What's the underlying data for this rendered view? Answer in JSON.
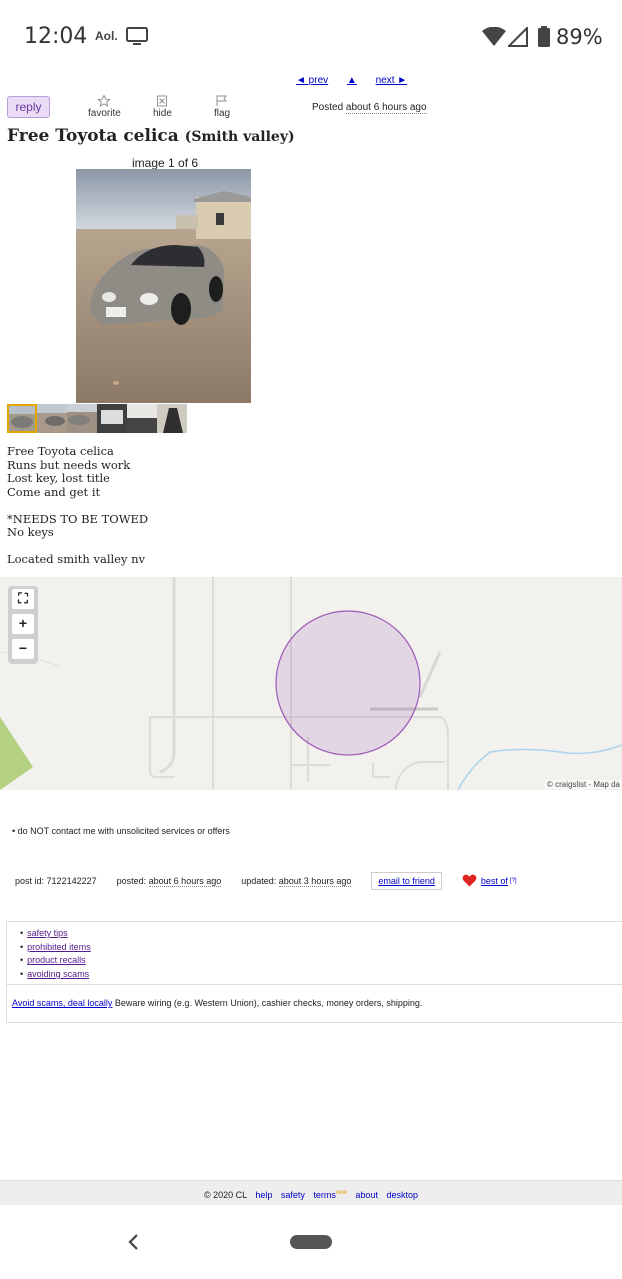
{
  "status_bar": {
    "time": "12:04",
    "carrier": "Aol.",
    "battery": "89%"
  },
  "nav": {
    "prev": "◄ prev",
    "up": "▲",
    "next": "next ►"
  },
  "actions": {
    "reply": "reply",
    "favorite": "favorite",
    "hide": "hide",
    "flag": "flag"
  },
  "posted_top": {
    "label": "Posted",
    "date": "about 6 hours ago"
  },
  "listing": {
    "title": "Free Toyota celica",
    "location": "(Smith valley)",
    "image_counter": "image 1 of 6",
    "thumbnail_count": 6,
    "selected_thumbnail": 1
  },
  "description": {
    "paragraphs": [
      [
        "Free Toyota celica",
        "Runs but needs work",
        "Lost key, lost title",
        "Come and get it"
      ],
      [
        "*NEEDS TO BE TOWED",
        "No keys"
      ],
      [
        "Located smith valley nv"
      ]
    ]
  },
  "map": {
    "fullscreen": "⛶",
    "zoom_in": "+",
    "zoom_out": "−",
    "attribution": "© craigslist - Map da"
  },
  "notice": "do NOT contact me with unsolicited services or offers",
  "post_info": {
    "post_id_label": "post id:",
    "post_id": "7122142227",
    "posted_label": "posted:",
    "posted": "about 6 hours ago",
    "updated_label": "updated:",
    "updated": "about 3 hours ago",
    "email": "email to friend",
    "best_of": "best of",
    "best_of_sup": "[?]"
  },
  "safety": {
    "links": [
      "safety tips",
      "prohibited items",
      "product recalls",
      "avoiding scams"
    ],
    "scam_link": "Avoid scams, deal locally",
    "scam_text": "Beware wiring (e.g. Western Union), cashier checks, money orders, shipping."
  },
  "footer": {
    "copyright": "© 2020 CL",
    "help": "help",
    "safety": "safety",
    "terms": "terms",
    "terms_badge": "new",
    "about": "about",
    "desktop": "desktop"
  },
  "colors": {
    "link": "#0000cc",
    "visited": "#551a8b",
    "reply_bg": "#eadcf6",
    "map_circle": "#9b59b6"
  }
}
